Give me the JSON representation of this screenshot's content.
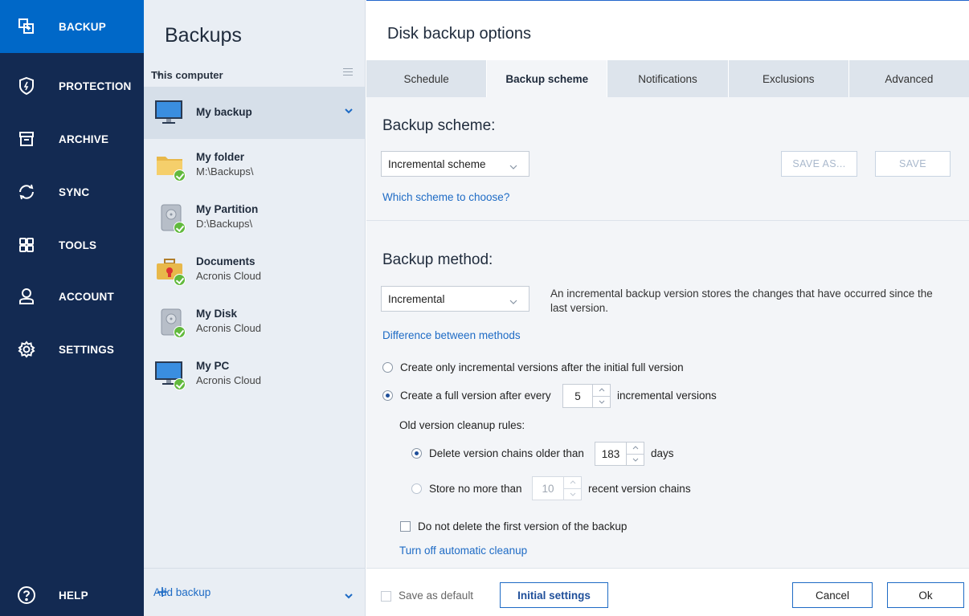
{
  "nav": {
    "items": [
      {
        "label": "BACKUP",
        "icon": "backup-icon"
      },
      {
        "label": "PROTECTION",
        "icon": "shield-icon"
      },
      {
        "label": "ARCHIVE",
        "icon": "archive-icon"
      },
      {
        "label": "SYNC",
        "icon": "sync-icon"
      },
      {
        "label": "TOOLS",
        "icon": "tools-icon"
      },
      {
        "label": "ACCOUNT",
        "icon": "account-icon"
      },
      {
        "label": "SETTINGS",
        "icon": "settings-icon"
      }
    ],
    "help": {
      "label": "HELP",
      "icon": "help-icon"
    },
    "active_color": "#0068c8",
    "bg_color": "#132a52"
  },
  "backups": {
    "title": "Backups",
    "group": "This computer",
    "items": [
      {
        "name": "My backup",
        "location": "",
        "icon": "monitor-icon"
      },
      {
        "name": "My folder",
        "location": "M:\\Backups\\",
        "icon": "folder-icon"
      },
      {
        "name": "My Partition",
        "location": "D:\\Backups\\",
        "icon": "disk-icon"
      },
      {
        "name": "Documents",
        "location": "Acronis Cloud",
        "icon": "briefcase-icon"
      },
      {
        "name": "My Disk",
        "location": "Acronis Cloud",
        "icon": "disk-icon"
      },
      {
        "name": "My PC",
        "location": "Acronis Cloud",
        "icon": "monitor-icon"
      }
    ],
    "add_label": "Add backup"
  },
  "main": {
    "title": "Disk backup options",
    "tabs": [
      "Schedule",
      "Backup scheme",
      "Notifications",
      "Exclusions",
      "Advanced"
    ],
    "active_tab": "Backup scheme",
    "scheme": {
      "heading": "Backup scheme:",
      "selected": "Incremental scheme",
      "save_as": "SAVE AS...",
      "save": "SAVE",
      "help_link": "Which scheme to choose?"
    },
    "method": {
      "heading": "Backup method:",
      "selected": "Incremental",
      "description": "An incremental backup version stores the changes that have occurred since the last version.",
      "help_link": "Difference between methods",
      "option1": "Create only incremental versions after the initial full version",
      "option2_pre": "Create a full version after every",
      "option2_value": "5",
      "option2_post": "incremental versions",
      "cleanup_label": "Old version cleanup rules:",
      "rule1_pre": "Delete version chains older than",
      "rule1_value": "183",
      "rule1_post": "days",
      "rule2_pre": "Store no more than",
      "rule2_value": "10",
      "rule2_post": "recent version chains",
      "keep_first": "Do not delete the first version of the backup",
      "turn_off_link": "Turn off automatic cleanup"
    },
    "footer": {
      "save_default": "Save as default",
      "initial": "Initial settings",
      "cancel": "Cancel",
      "ok": "Ok"
    }
  }
}
